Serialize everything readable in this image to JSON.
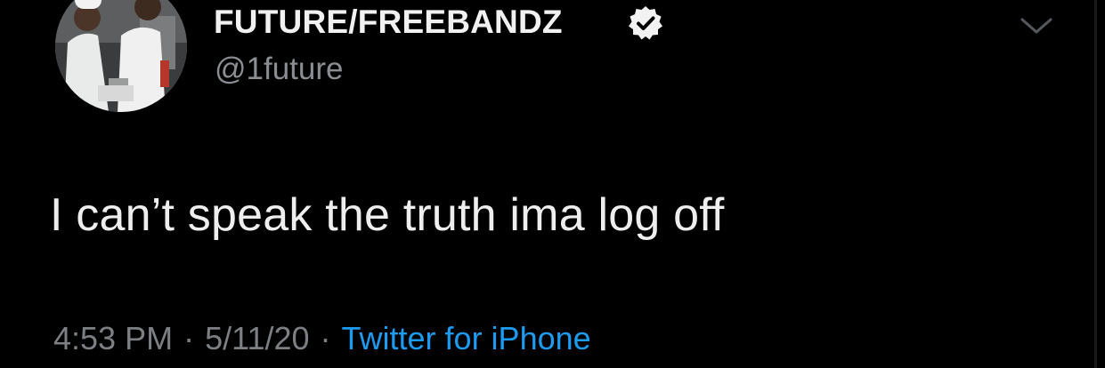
{
  "tweet": {
    "author": {
      "display_name": "FUTURE/FREEBANDZ",
      "handle": "@1future",
      "verified": true,
      "avatar_icon": "avatar-photo"
    },
    "menu_icon": "chevron-down-icon",
    "text": "I can’t speak the truth ima log off",
    "meta": {
      "time": "4:53 PM",
      "separator": "·",
      "date": "5/11/20",
      "source": "Twitter for iPhone"
    }
  },
  "colors": {
    "background": "#000000",
    "text": "#eeeeee",
    "muted": "#7c7f83",
    "link": "#1d9bf0"
  }
}
